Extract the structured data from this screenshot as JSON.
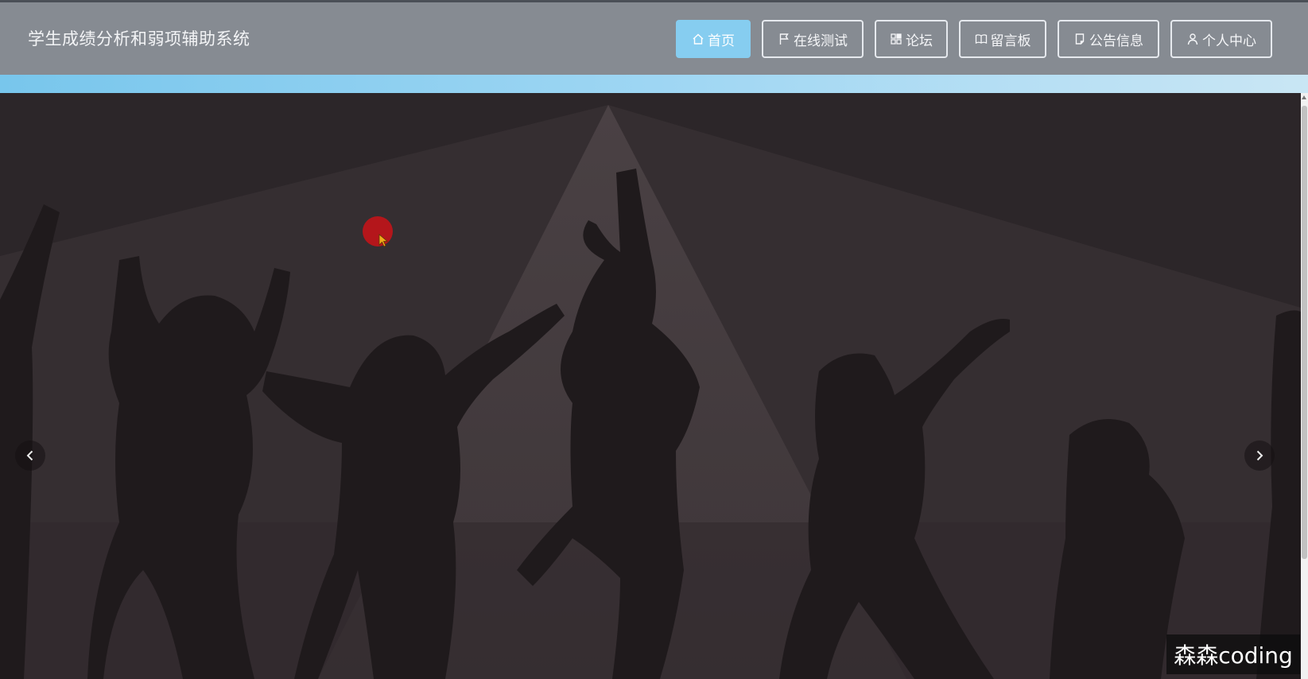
{
  "header": {
    "title": "学生成绩分析和弱项辅助系统"
  },
  "nav": {
    "items": [
      {
        "label": "首页",
        "icon": "home-icon",
        "active": true
      },
      {
        "label": "在线测试",
        "icon": "flag-icon",
        "active": false
      },
      {
        "label": "论坛",
        "icon": "apps-icon",
        "active": false
      },
      {
        "label": "留言板",
        "icon": "book-icon",
        "active": false
      },
      {
        "label": "公告信息",
        "icon": "document-icon",
        "active": false
      },
      {
        "label": "个人中心",
        "icon": "user-icon",
        "active": false
      }
    ]
  },
  "banner": {
    "prev_icon": "chevron-left-icon",
    "next_icon": "chevron-right-icon"
  },
  "watermark": {
    "text": "森森coding"
  },
  "colors": {
    "header_bg": "#868b92",
    "active_button": "#86cdf0",
    "accent_strip": "#78c6ec",
    "banner_bg": "#2d272a",
    "cursor_marker": "#b4161b"
  }
}
